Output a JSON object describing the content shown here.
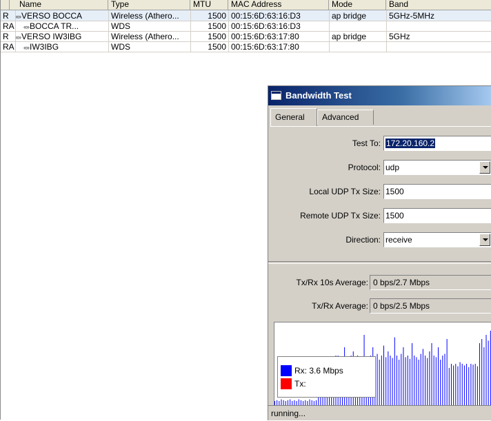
{
  "interfaces": {
    "columns": [
      {
        "key": "flags",
        "label": ""
      },
      {
        "key": "name",
        "label": "Name"
      },
      {
        "key": "type",
        "label": "Type"
      },
      {
        "key": "mtu",
        "label": "MTU"
      },
      {
        "key": "mac",
        "label": "MAC Address"
      },
      {
        "key": "mode",
        "label": "Mode"
      },
      {
        "key": "band",
        "label": "Band"
      }
    ],
    "rows": [
      {
        "flags": "R",
        "name": "VERSO BOCCA",
        "type": "Wireless (Athero...",
        "mtu": "1500",
        "mac": "00:15:6D:63:16:D3",
        "mode": "ap bridge",
        "band": "5GHz-5MHz",
        "selected": true
      },
      {
        "flags": "RA",
        "name": "BOCCA TR...",
        "type": "WDS",
        "mtu": "1500",
        "mac": "00:15:6D:63:16:D3",
        "mode": "",
        "band": "",
        "selected": false,
        "indent": true
      },
      {
        "flags": "R",
        "name": "VERSO IW3IBG",
        "type": "Wireless (Athero...",
        "mtu": "1500",
        "mac": "00:15:6D:63:17:80",
        "mode": "ap bridge",
        "band": "5GHz",
        "selected": false
      },
      {
        "flags": "RA",
        "name": "IW3IBG",
        "type": "WDS",
        "mtu": "1500",
        "mac": "00:15:6D:63:17:80",
        "mode": "",
        "band": "",
        "selected": false,
        "indent": true
      }
    ],
    "link_glyph": "«»",
    "sort_icon": "triangle-up-icon"
  },
  "bandwidth_test": {
    "title": "Bandwidth Test",
    "tabs": [
      {
        "label": "General",
        "active": true
      },
      {
        "label": "Advanced",
        "active": false
      }
    ],
    "fields": {
      "test_to": {
        "label": "Test To:",
        "value": "172.20.160.2"
      },
      "protocol": {
        "label": "Protocol:",
        "value": "udp"
      },
      "local_udp_tx_size": {
        "label": "Local UDP Tx Size:",
        "value": "1500"
      },
      "remote_udp_tx_size": {
        "label": "Remote UDP Tx Size:",
        "value": "1500"
      },
      "direction": {
        "label": "Direction:",
        "value": "receive"
      }
    },
    "stats": {
      "avg10s": {
        "label": "Tx/Rx 10s Average:",
        "value": "0 bps/2.7 Mbps"
      },
      "avg": {
        "label": "Tx/Rx Average:",
        "value": "0 bps/2.5 Mbps"
      }
    },
    "graph": {
      "rx_color": "#0000ff",
      "tx_color": "#ff0000",
      "rx_label": "Rx: 3.6 Mbps",
      "tx_label": "Tx:",
      "rx_levels": [
        0.05,
        0.06,
        0.05,
        0.07,
        0.06,
        0.05,
        0.06,
        0.07,
        0.05,
        0.06,
        0.05,
        0.07,
        0.06,
        0.05,
        0.06,
        0.05,
        0.07,
        0.06,
        0.05,
        0.06,
        0.2,
        0.25,
        0.3,
        0.35,
        0.4,
        0.45,
        0.5,
        0.55,
        0.6,
        0.6,
        0.35,
        0.45,
        0.7,
        0.55,
        0.5,
        0.6,
        0.65,
        0.55,
        0.6,
        0.5,
        0.55,
        0.85,
        0.4,
        0.55,
        0.6,
        0.7,
        0.58,
        0.62,
        0.55,
        0.6,
        0.72,
        0.58,
        0.65,
        0.6,
        0.57,
        0.82,
        0.6,
        0.55,
        0.62,
        0.7,
        0.58,
        0.6,
        0.56,
        0.75,
        0.6,
        0.58,
        0.55,
        0.62,
        0.68,
        0.6,
        0.57,
        0.65,
        0.75,
        0.6,
        0.58,
        0.7,
        0.55,
        0.6,
        0.62,
        0.8,
        0.45,
        0.5,
        0.48,
        0.5,
        0.47,
        0.52,
        0.5,
        0.48,
        0.5,
        0.46,
        0.5,
        0.49,
        0.5,
        0.47,
        0.75,
        0.8,
        0.7,
        0.85,
        0.78,
        0.9
      ]
    },
    "status": "running..."
  }
}
